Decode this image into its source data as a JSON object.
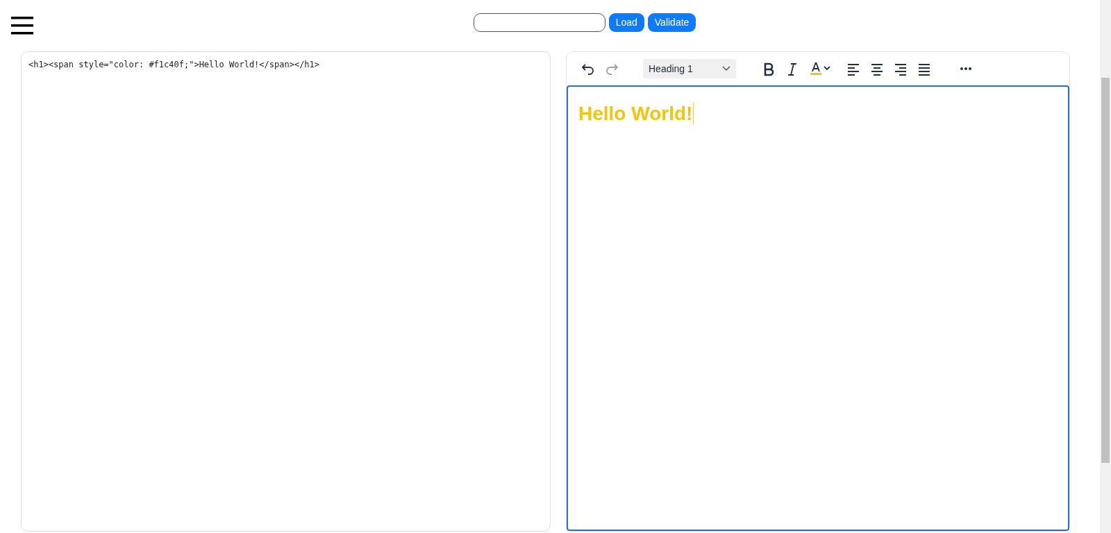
{
  "top_bar": {
    "buttons": [
      "Load",
      "Validate"
    ]
  },
  "source_code": "<h1><span style=\"color: #f1c40f;\">Hello World!</span></h1>",
  "editor": {
    "toolbar": [
      {
        "kind": "undo",
        "disabled": false
      },
      {
        "kind": "redo",
        "disabled": true
      },
      {
        "kind": "block-format",
        "label": "Heading 1",
        "disabled": false
      },
      {
        "kind": "bold",
        "disabled": false
      },
      {
        "kind": "italic",
        "disabled": false
      },
      {
        "kind": "text-color",
        "disabled": false
      },
      {
        "kind": "align-left",
        "disabled": false
      },
      {
        "kind": "align-center",
        "disabled": false
      },
      {
        "kind": "align-right",
        "disabled": false
      },
      {
        "kind": "justify",
        "disabled": false
      },
      {
        "kind": "more",
        "disabled": false
      }
    ],
    "content": "Hello World!"
  }
}
